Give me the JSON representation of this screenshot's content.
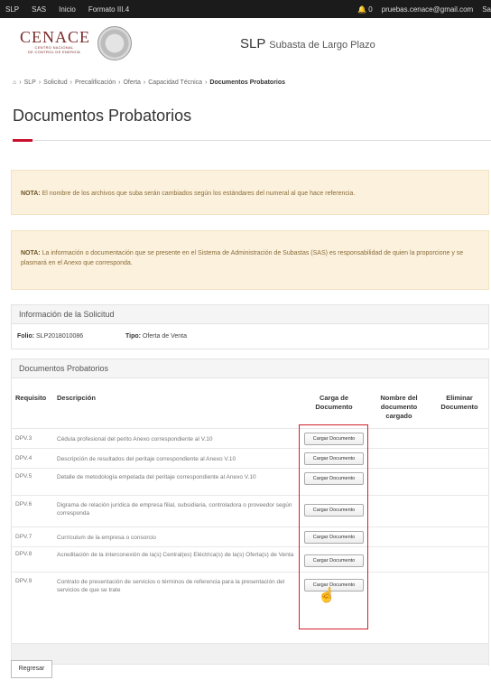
{
  "topbar": {
    "nav": [
      "SLP",
      "SAS",
      "Inicio",
      "Formato III.4"
    ],
    "notif_count": "0",
    "user_email": "pruebas.cenace@gmail.com",
    "exit_label": "Sa"
  },
  "header": {
    "logo_main": "CENACE",
    "logo_sub1": "CENTRO NACIONAL",
    "logo_sub2": "DE CONTROL DE ENERGÍA",
    "app_name": "SLP",
    "app_subtitle": "Subasta de Largo Plazo"
  },
  "breadcrumb": {
    "items": [
      "SLP",
      "Solicitud",
      "Precalificación",
      "Oferta",
      "Capacidad Técnica"
    ],
    "current": "Documentos Probatorios"
  },
  "page_title": "Documentos Probatorios",
  "notes": [
    {
      "label": "NOTA:",
      "text": "El nombre de los archivos que suba serán cambiados según los estándares del numeral al que hace referencia."
    },
    {
      "label": "NOTA:",
      "text": "La información o documentación que se presente en el Sistema de Administración de Subastas (SAS) es responsabilidad de quien la proporcione y se plasmará en el Anexo que corresponda."
    }
  ],
  "info_panel": {
    "title": "Información de la Solicitud",
    "folio_label": "Folio:",
    "folio_value": "SLP2018010086",
    "tipo_label": "Tipo:",
    "tipo_value": "Oferta de Venta"
  },
  "docs_panel": {
    "title": "Documentos Probatorios",
    "headers": {
      "requisito": "Requisito",
      "descripcion": "Descripción",
      "carga_1": "Carga de",
      "carga_2": "Documento",
      "nombre_1": "Nombre del",
      "nombre_2": "documento",
      "nombre_3": "cargado",
      "eliminar_1": "Eliminar",
      "eliminar_2": "Documento"
    },
    "button_label": "Cargar Documento",
    "rows": [
      {
        "code": "DPV.3",
        "desc": "Cédula profesional del perito Anexo correspondiente al V.10"
      },
      {
        "code": "DPV.4",
        "desc": "Descripción de resultados del peritaje correspondiente al Anexo V.10"
      },
      {
        "code": "DPV.5",
        "desc": "Detalle de metodología empelada del peritaje correspondiente al Anexo V.10"
      },
      {
        "code": "DPV.6",
        "desc": "Digrama de relación jurídica de empresa filial, subsidiaria, controladora o proveedor según corresponda"
      },
      {
        "code": "DPV.7",
        "desc": "Currículum de la empresa o consorcio"
      },
      {
        "code": "DPV.8",
        "desc": "Acreditación de la interconexión de la(s) Central(es) Eléctrica(s) de la(s) Oferta(s) de Venta"
      },
      {
        "code": "DPV.9",
        "desc": "Contrato de presentación de servicios o términos de referencia para la presentación del servicios de que se trate"
      }
    ]
  },
  "back_button": "Regresar",
  "colors": {
    "accent": "#c8102e",
    "note_bg": "#fcf1dc",
    "topbar": "#1b1b1b"
  }
}
